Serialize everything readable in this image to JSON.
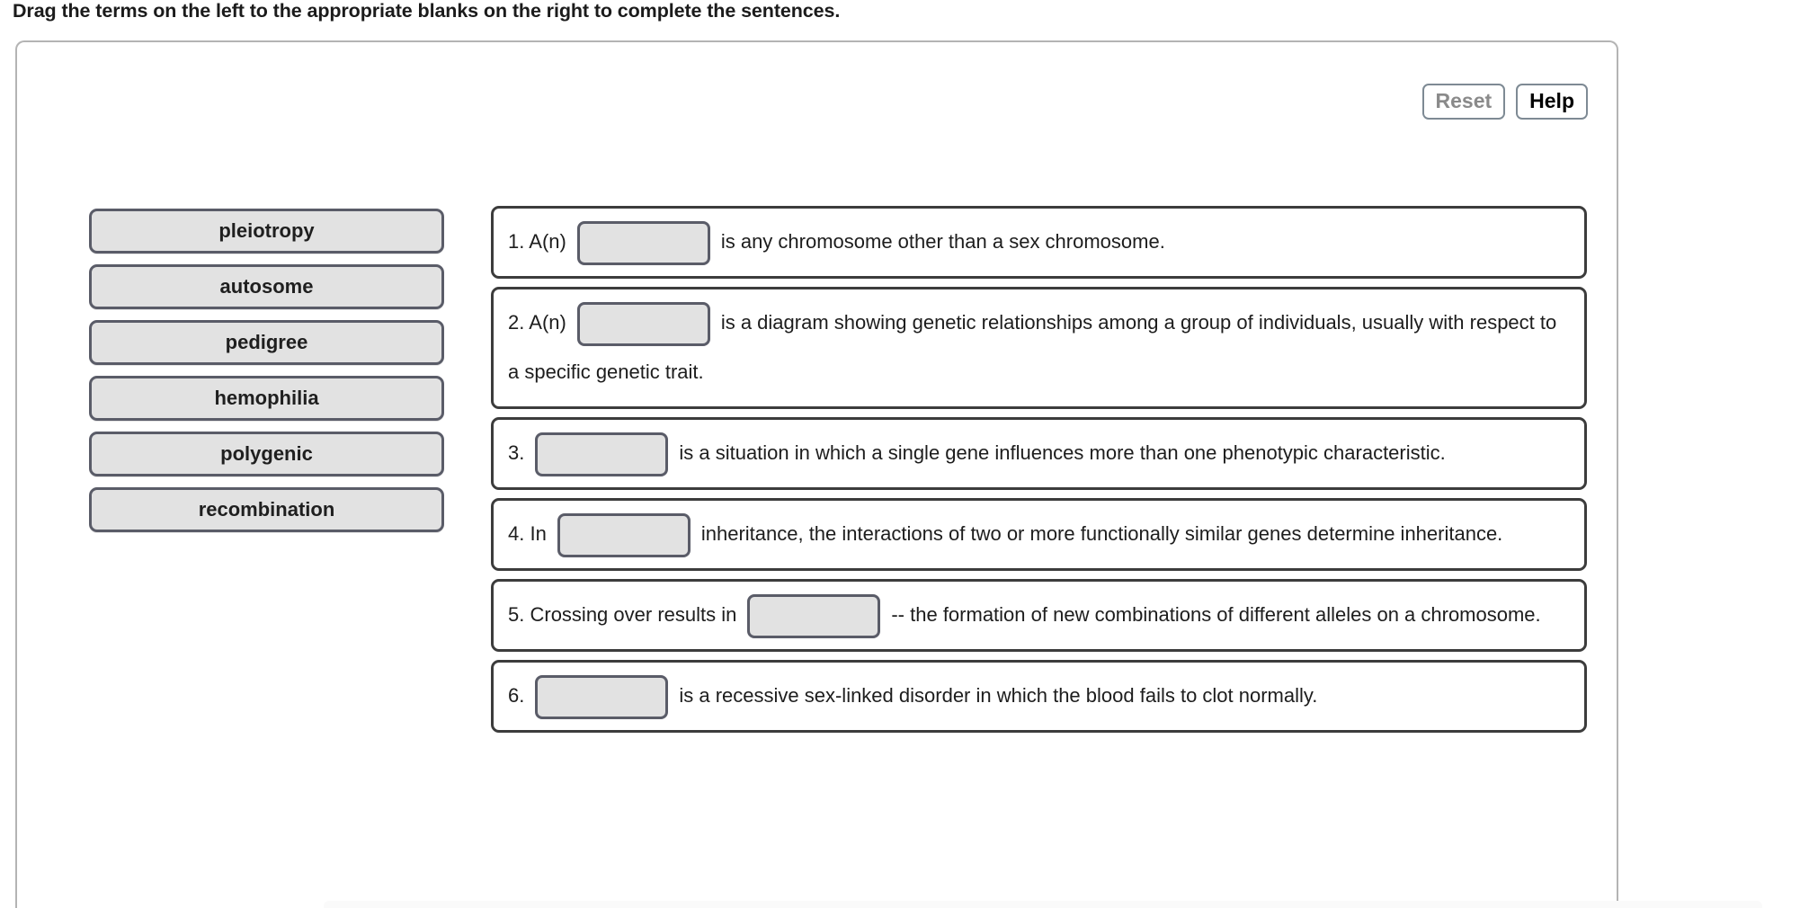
{
  "prompt": "Drag the terms on the left to the appropriate blanks on the right to complete the sentences.",
  "toolbar": {
    "reset_label": "Reset",
    "help_label": "Help"
  },
  "colors": {
    "chip_fill": "#e2e2e2",
    "chip_border": "#5a5c68",
    "row_border": "#3c3c3c",
    "panel_border": "#b4b4b4",
    "reset_text": "#8a8a8a",
    "help_text": "#000000"
  },
  "terms": [
    {
      "label": "pleiotropy"
    },
    {
      "label": "autosome"
    },
    {
      "label": "pedigree"
    },
    {
      "label": "hemophilia"
    },
    {
      "label": "polygenic"
    },
    {
      "label": "recombination"
    }
  ],
  "sentences": [
    {
      "number": "1.",
      "before": "A(n)",
      "blank_value": "",
      "after": "is any chromosome other than a sex chromosome."
    },
    {
      "number": "2.",
      "before": "A(n)",
      "blank_value": "",
      "after": "is a diagram showing genetic relationships among a group of individuals, usually with respect to a specific genetic trait."
    },
    {
      "number": "3.",
      "before": "",
      "blank_value": "",
      "after": "is a situation in which a single gene influences more than one phenotypic characteristic."
    },
    {
      "number": "4.",
      "before": "In",
      "blank_value": "",
      "after": "inheritance, the interactions of two or more functionally similar genes determine inheritance."
    },
    {
      "number": "5.",
      "before": "Crossing over results in",
      "blank_value": "",
      "after": "-- the formation of new combinations of different alleles on a chromosome."
    },
    {
      "number": "6.",
      "before": "",
      "blank_value": "",
      "after": "is a recessive sex-linked disorder in which the blood fails to clot normally."
    }
  ]
}
